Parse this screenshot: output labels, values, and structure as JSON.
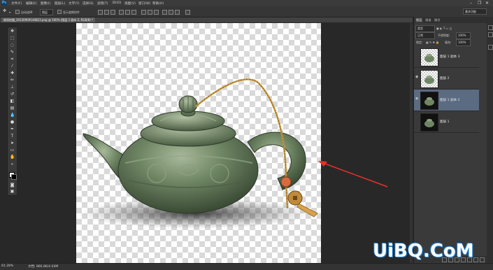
{
  "app": {
    "logo": "Ps"
  },
  "menu": {
    "items": [
      "文件(F)",
      "编辑(E)",
      "图像(I)",
      "图层(L)",
      "文字(Y)",
      "选择(S)",
      "滤镜(T)",
      "3D(D)",
      "视图(V)",
      "窗口(W)",
      "帮助(H)"
    ]
  },
  "window_controls": {
    "minimize": "–",
    "restore": "❐",
    "close": "✕"
  },
  "options": {
    "auto_select_label": "自动选择:",
    "auto_select_value": "图层",
    "show_transform_label": "显示变换控件",
    "workspace": "基本功能"
  },
  "tabs": [
    {
      "label": "继续拍摄_20130909140823.png @ 100% (图层 1 副本 2, RGB/8) *"
    },
    {
      "label": "图层 1 副本 2, RGB/8"
    }
  ],
  "status": {
    "zoom": "81.28%",
    "doc": "文档: 866.8K/4.04M"
  },
  "panel": {
    "tabs": [
      "图层",
      "通道",
      "路径"
    ],
    "kind_filter": "类型",
    "blend_mode": "正常",
    "opacity_label": "不透明度:",
    "opacity_value": "100%",
    "lock_label": "锁定:",
    "fill_label": "填充:",
    "fill_value": "100%",
    "layers": [
      {
        "name": "图层 1 副本 3",
        "visible": false,
        "selected": false,
        "dark": false
      },
      {
        "name": "图层 2",
        "visible": true,
        "selected": false,
        "dark": false
      },
      {
        "name": "图层 1 副本 2",
        "visible": true,
        "selected": true,
        "dark": true
      },
      {
        "name": "图层 1",
        "visible": false,
        "selected": false,
        "dark": true
      }
    ]
  },
  "watermark": {
    "text": "UiBQ.CoM"
  },
  "colors": {
    "accent": "#1e7ed0",
    "selected_layer": "#5b6b82",
    "annotation_arrow": "#e8312a"
  }
}
